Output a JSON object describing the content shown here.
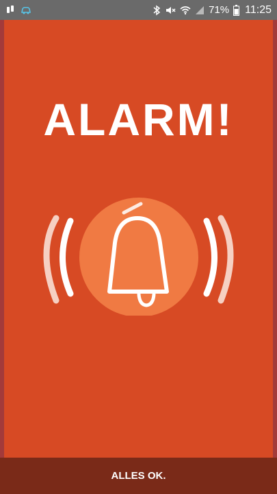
{
  "status_bar": {
    "battery_percent": "71%",
    "time": "11:25",
    "icons": [
      "notification-icon",
      "car-icon",
      "bluetooth-icon",
      "mute-icon",
      "wifi-icon",
      "signal-icon",
      "battery-icon"
    ]
  },
  "alarm": {
    "title": "ALARM!",
    "icon": "ringing-bell-icon"
  },
  "footer": {
    "button_label": "ALLES OK."
  },
  "colors": {
    "background": "#d74a24",
    "status_bar": "#6a6a6a",
    "bell_circle": "#f07a43",
    "footer": "#7a2a18"
  }
}
